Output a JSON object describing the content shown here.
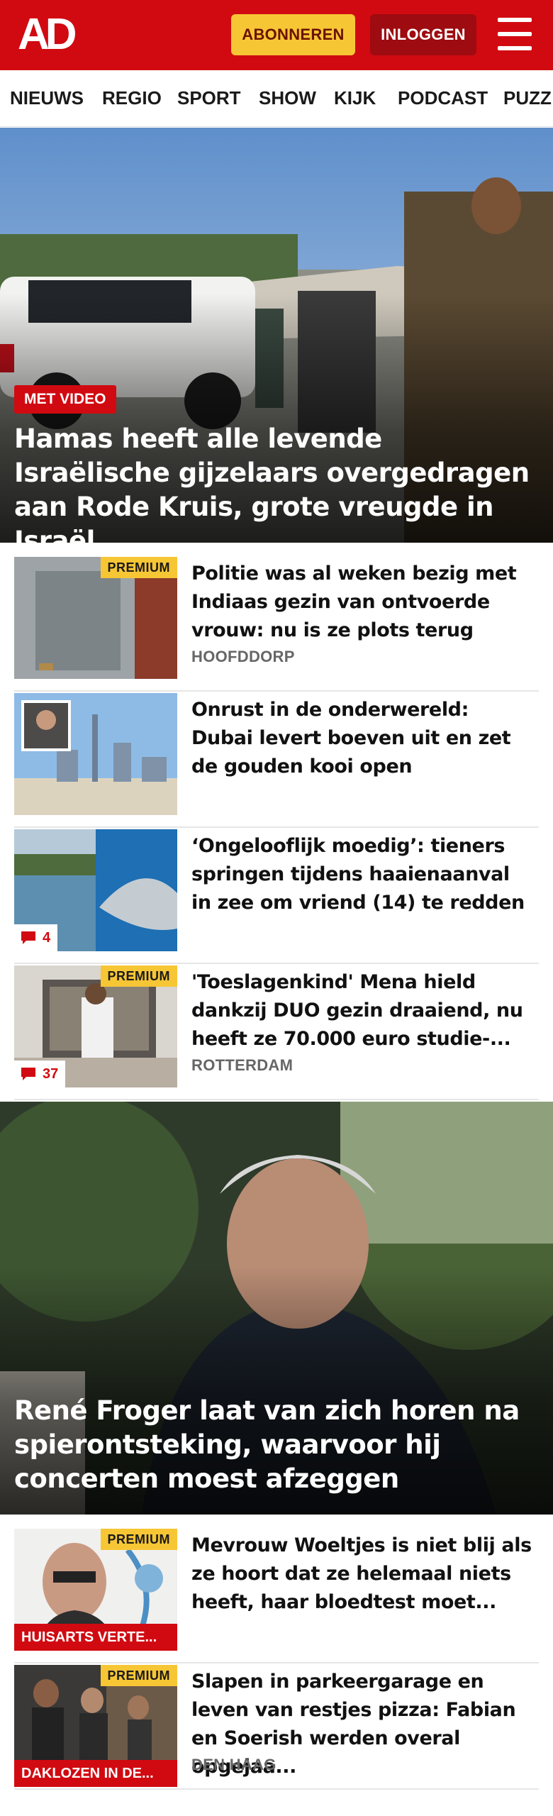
{
  "header": {
    "logo": "AD",
    "subscribe_label": "ABONNEREN",
    "login_label": "INLOGGEN",
    "brand_color": "#d10a11",
    "accent_color": "#f7c635"
  },
  "nav": {
    "items": [
      "NIEUWS",
      "REGIO",
      "SPORT",
      "SHOW",
      "KIJK",
      "PODCAST",
      "PUZZ"
    ]
  },
  "hero1": {
    "badge": "MET VIDEO",
    "title": "Hamas heeft alle levende Israëlische gijzelaars overgedragen aan Rode Kruis, grote vreugde in Israël"
  },
  "articles1": [
    {
      "title": "Politie was al weken bezig met Indiaas gezin van ontvoerde vrouw: nu is ze plots terug",
      "location": "HOOFDDORP",
      "premium": "PREMIUM"
    },
    {
      "title": "Onrust in de onderwereld: Dubai levert boeven uit en zet de gouden kooi open"
    },
    {
      "title": "‘Ongelooflijk moedig’: tieners springen tijdens haaienaanval in zee om vriend (14) te redden",
      "comments": "4"
    },
    {
      "title": "'Toeslagenkind' Mena hield dankzij DUO gezin draaiend, nu heeft ze 70.000 euro studie-...",
      "location": "ROTTERDAM",
      "premium": "PREMIUM",
      "comments": "37"
    }
  ],
  "hero2": {
    "title": "René Froger laat van zich horen na spierontsteking, waarvoor hij concerten moest afzeggen"
  },
  "articles2": [
    {
      "title": "Mevrouw Woeltjes is niet blij als ze hoort dat ze helemaal niets heeft, haar bloedtest moet...",
      "premium": "PREMIUM",
      "tag": "HUISARTS VERTE..."
    },
    {
      "title": "Slapen in parkeergarage en leven van restjes pizza: Fabian en Soerish werden overal opgejaa...",
      "location": "DEN HAAG",
      "premium": "PREMIUM",
      "tag": "DAKLOZEN IN DE..."
    }
  ]
}
